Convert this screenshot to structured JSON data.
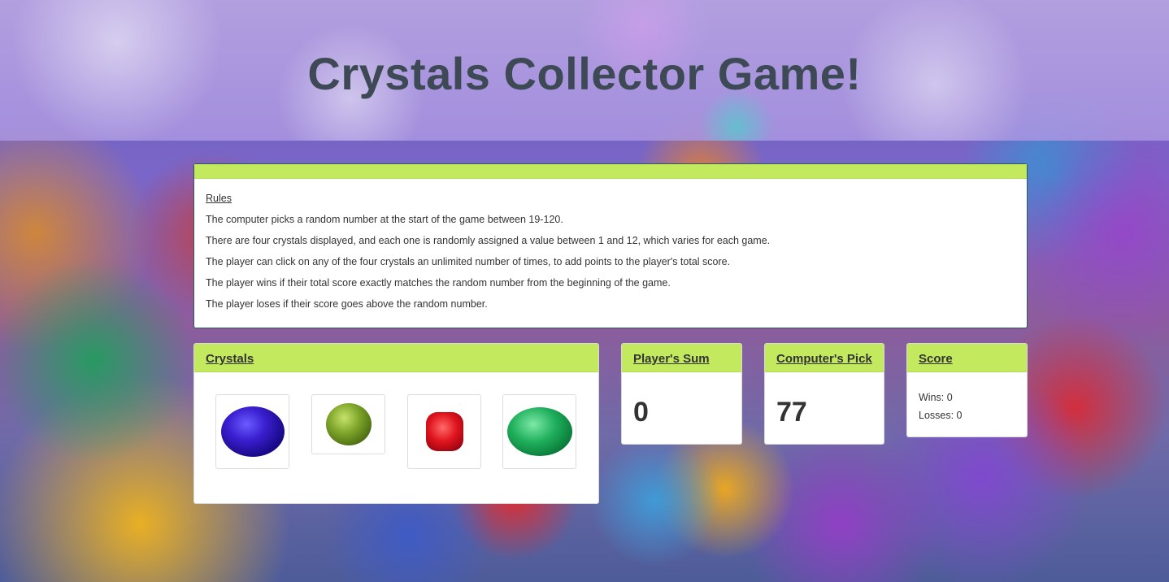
{
  "page": {
    "title": "Crystals Collector Game!"
  },
  "rules": {
    "label": "Rules",
    "lines": [
      "The computer picks a random number at the start of the game between 19-120.",
      "There are four crystals displayed, and each one is randomly assigned a value between 1 and 12, which varies for each game.",
      "The player can click on any of the four crystals an unlimited number of times, to add points to the player's total score.",
      "The player wins if their total score exactly matches the random number from the beginning of the game.",
      "The player loses if their score goes above the random number."
    ]
  },
  "crystals": {
    "title": "Crystals",
    "items": [
      {
        "name": "blue-sapphire",
        "color": "#3a1fd0"
      },
      {
        "name": "green-peridot",
        "color": "#7ea42a"
      },
      {
        "name": "red-ruby",
        "color": "#e0141e"
      },
      {
        "name": "green-emerald",
        "color": "#1fb05c"
      }
    ]
  },
  "player_sum": {
    "title": "Player's Sum",
    "value": "0"
  },
  "computer_pick": {
    "title": "Computer's Pick",
    "value": "77"
  },
  "score": {
    "title": "Score",
    "wins": "Wins: 0",
    "losses": "Losses: 0"
  },
  "colors": {
    "panel_header": "#c3ea5f",
    "title_text": "#3d4a55"
  }
}
